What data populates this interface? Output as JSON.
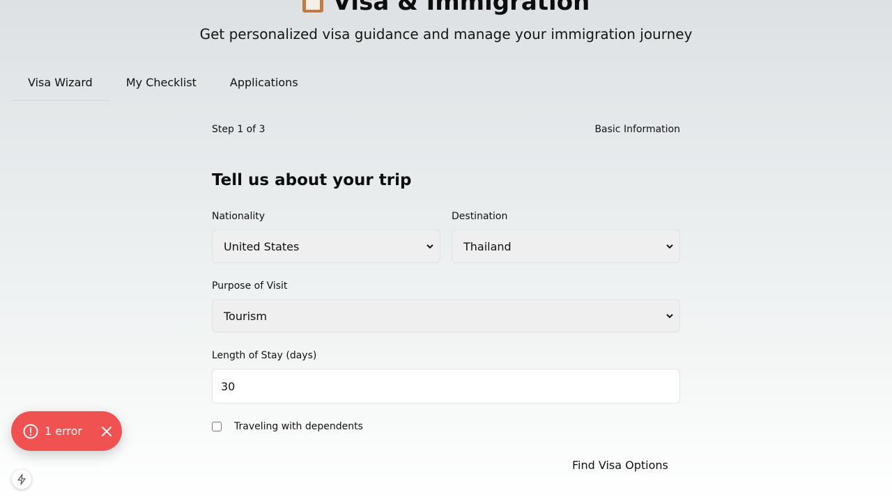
{
  "header": {
    "icon": "clipboard-icon",
    "title": "Visa & Immigration",
    "subtitle": "Get personalized visa guidance and manage your immigration journey"
  },
  "tabs": [
    {
      "label": "Visa Wizard",
      "active": true
    },
    {
      "label": "My Checklist",
      "active": false
    },
    {
      "label": "Applications",
      "active": false
    }
  ],
  "wizard": {
    "step_text": "Step 1 of 3",
    "step_name": "Basic Information",
    "form_title": "Tell us about your trip",
    "fields": {
      "nationality": {
        "label": "Nationality",
        "value": "United States"
      },
      "destination": {
        "label": "Destination",
        "value": "Thailand"
      },
      "purpose": {
        "label": "Purpose of Visit",
        "value": "Tourism"
      },
      "stay_length": {
        "label": "Length of Stay (days)",
        "value": "30"
      }
    },
    "dependents_label": "Traveling with dependents",
    "dependents_checked": false,
    "submit_label": "Find Visa Options"
  },
  "error_toast": {
    "text": "1 error",
    "color": "#f05252",
    "icon": "alert-circle-icon"
  },
  "colors": {
    "error": "#f05252",
    "select_bg": "#efefef",
    "border": "#e2e2e2"
  }
}
